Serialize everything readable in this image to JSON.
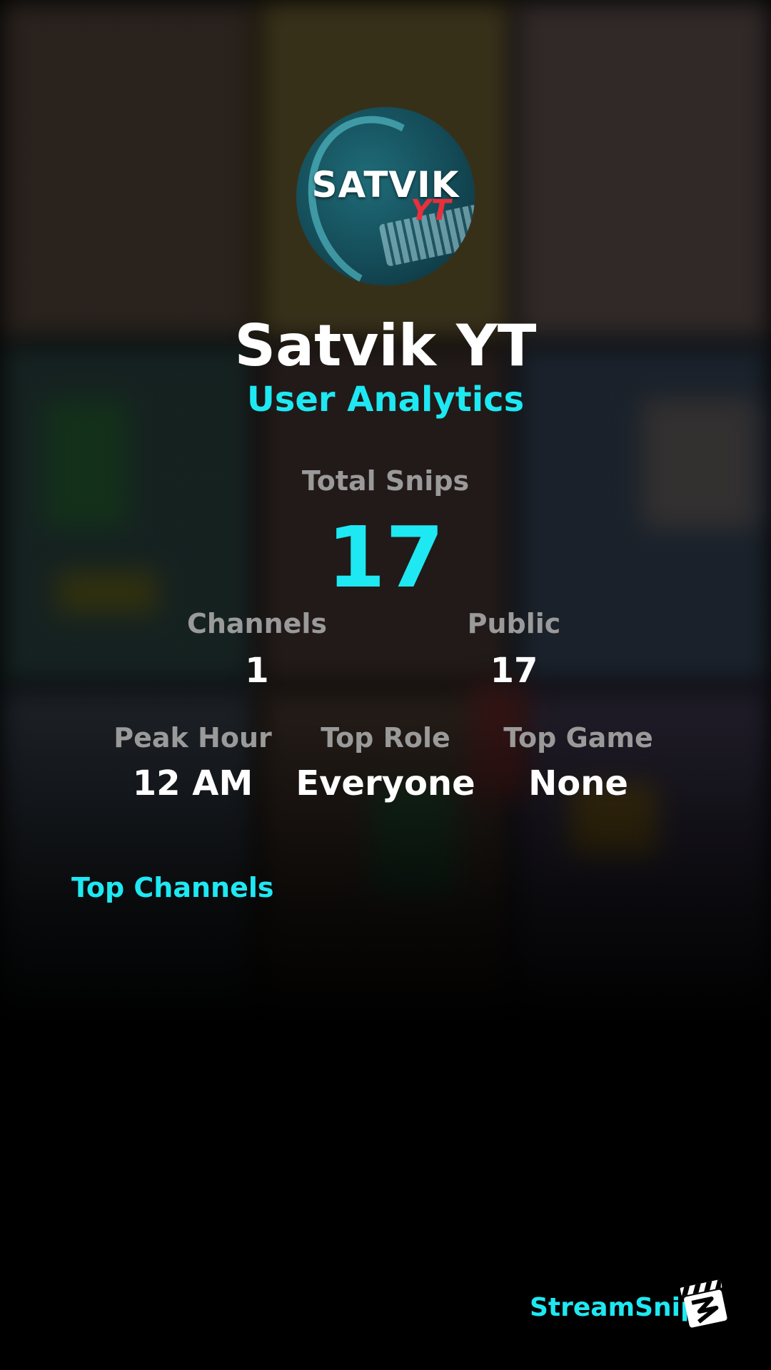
{
  "profile": {
    "avatar_text": "SATVIK",
    "avatar_sub": "YT",
    "name": "Satvik YT",
    "subtitle": "User Analytics"
  },
  "stats": {
    "total_snips_label": "Total Snips",
    "total_snips_value": "17",
    "channels_label": "Channels",
    "channels_value": "1",
    "public_label": "Public",
    "public_value": "17",
    "peak_hour_label": "Peak Hour",
    "peak_hour_value": "12 AM",
    "top_role_label": "Top Role",
    "top_role_value": "Everyone",
    "top_game_label": "Top Game",
    "top_game_value": "None"
  },
  "sections": {
    "top_channels_title": "Top Channels"
  },
  "branding": {
    "name": "StreamSnip",
    "logo_icon": "clapperboard-icon"
  },
  "colors": {
    "accent": "#1ee8f2",
    "label": "#9a9a9a",
    "text": "#ffffff",
    "background": "#000000"
  }
}
